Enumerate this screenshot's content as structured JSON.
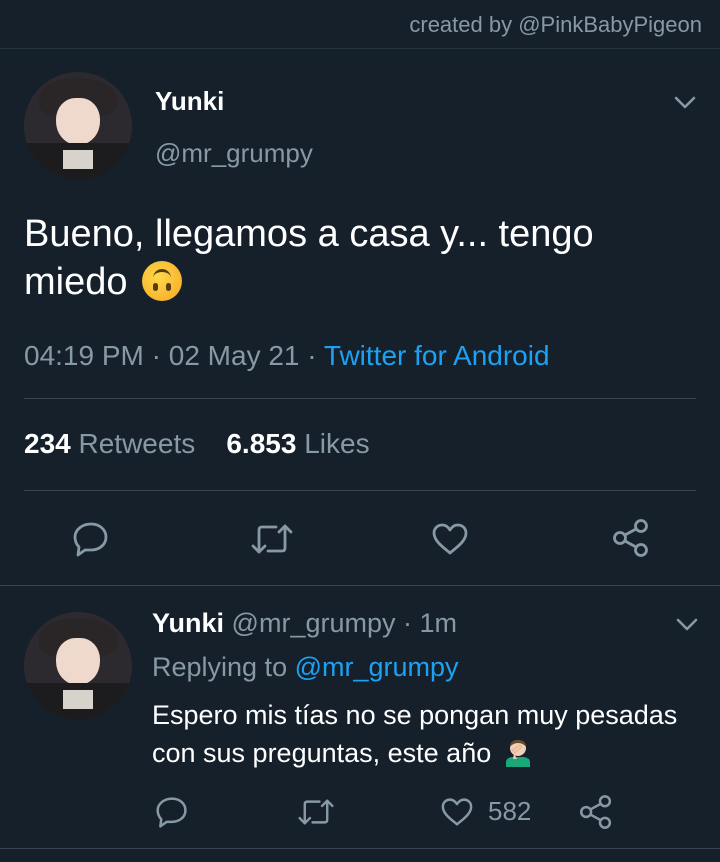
{
  "credit": "created by @PinkBabyPigeon",
  "main_tweet": {
    "name": "Yunki",
    "handle": "@mr_grumpy",
    "text": "Bueno, llegamos a casa y... tengo miedo",
    "emoji": "upside-down-face",
    "time": "04:19 PM",
    "date": "02 May 21",
    "source": "Twitter for Android",
    "retweets_count": "234",
    "retweets_label": "Retweets",
    "likes_count": "6.853",
    "likes_label": "Likes"
  },
  "reply_tweet": {
    "name": "Yunki",
    "handle": "@mr_grumpy",
    "age": "1m",
    "replying_label": "Replying to",
    "replying_to": "@mr_grumpy",
    "text": "Espero mis tías no se pongan muy pesadas con sus preguntas, este año",
    "emoji": "person-facepalming",
    "like_count": "582"
  },
  "colors": {
    "background": "#15202b",
    "accent": "#1da1f2",
    "secondary_text": "#8899a6",
    "divider": "#38444d"
  },
  "icons": [
    "chevron-down-icon",
    "reply-icon",
    "retweet-icon",
    "like-icon",
    "share-icon"
  ]
}
